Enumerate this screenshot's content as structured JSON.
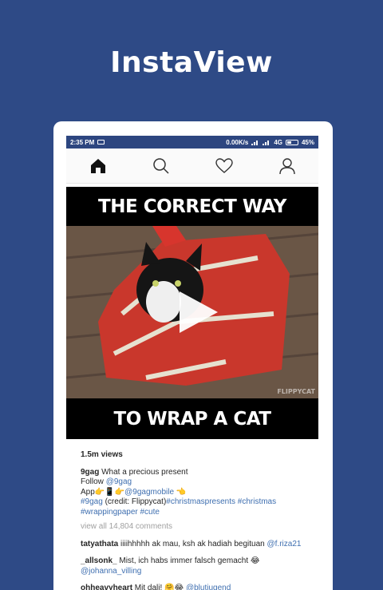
{
  "app_title": "InstaView",
  "status": {
    "time": "2:35 PM",
    "speed": "0.00K/s",
    "network": "4G",
    "battery": "45%"
  },
  "nav": {
    "icons": [
      "home-icon",
      "search-icon",
      "heart-icon",
      "profile-icon"
    ]
  },
  "video": {
    "top_text": "THE CORRECT WAY",
    "bottom_text": "TO WRAP A CAT",
    "watermark": "FLIPPYCAT"
  },
  "post": {
    "views": "1.5m views",
    "caption": {
      "user": "9gag",
      "text": " What a precious present",
      "line2_prefix": "Follow ",
      "line2_link": "@9gag",
      "line3_prefix": "App👉📱👉",
      "line3_link": "@9gagmobile",
      "line3_suffix": " 👈",
      "line4_link1": "#9gag",
      "line4_text": " (credit: Flippycat)",
      "line4_link2": "#christmaspresents",
      "line4_link3": " #christmas",
      "line5_link1": "#wrappingpaper",
      "line5_link2": " #cute"
    },
    "view_all": "view all 14,804 comments",
    "comments": [
      {
        "user": "tatyathata",
        "text": " iiiihhhhh ak mau, ksh ak hadiah begituan ",
        "mention": "@f.riza21"
      },
      {
        "user": "_allsonk_",
        "text": " Mist, ich habs immer falsch gemacht 😂",
        "mention": "@johanna_villing"
      },
      {
        "user": "ohheavyheart",
        "text": " Mit dali! 🤗😂 ",
        "mention": "@blutjugend"
      }
    ]
  }
}
